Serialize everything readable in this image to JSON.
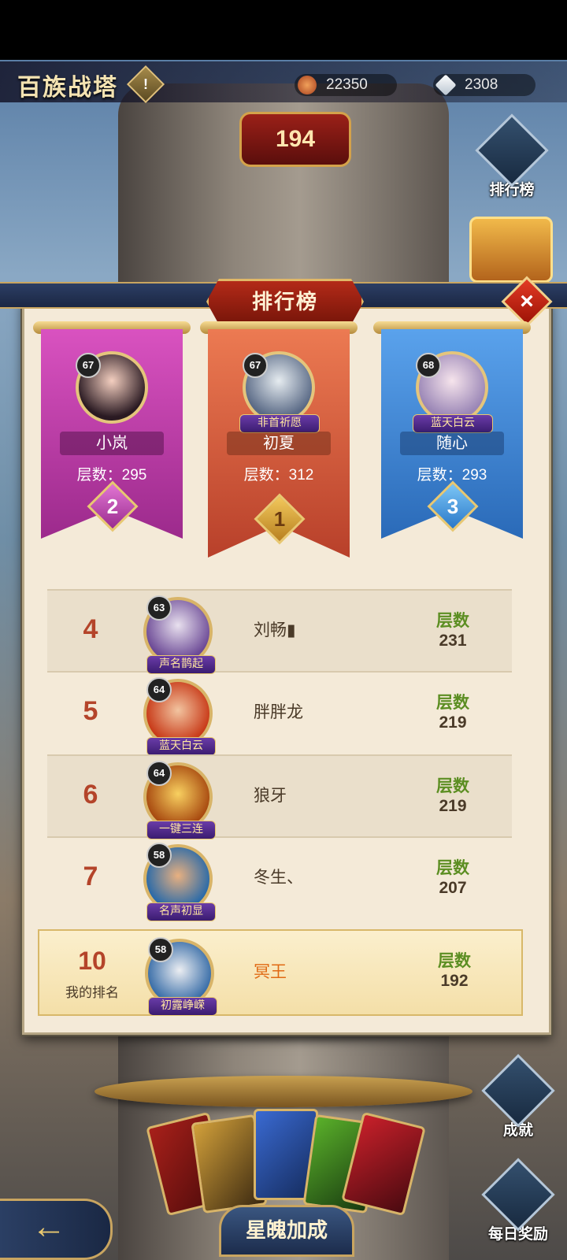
{
  "header": {
    "game_title": "百族战塔",
    "info_icon": "!",
    "currencies": [
      {
        "icon": "coin-icon",
        "value": "22350"
      },
      {
        "icon": "diamond-icon",
        "value": "2308"
      }
    ],
    "current_floor": "194"
  },
  "side_buttons": {
    "ranking": "排行榜",
    "achievement": "成就",
    "daily_reward": "每日奖励"
  },
  "modal": {
    "title": "排行榜",
    "close_icon": "×",
    "podium": [
      {
        "rank": "2",
        "level": "67",
        "name": "小岚",
        "layers": "层数：295",
        "title_tag": "",
        "color": "#c23fa8"
      },
      {
        "rank": "1",
        "level": "67",
        "name": "初夏",
        "layers": "层数：312",
        "title_tag": "非首祈愿",
        "color": "#e0653f"
      },
      {
        "rank": "3",
        "level": "68",
        "name": "随心",
        "layers": "层数：293",
        "title_tag": "蓝天白云",
        "color": "#3e8ad8"
      }
    ],
    "rows": [
      {
        "rank": "4",
        "level": "63",
        "title_tag": "声名鹊起",
        "name": "刘畅▮",
        "layers_label": "层数",
        "layers": "231"
      },
      {
        "rank": "5",
        "level": "64",
        "title_tag": "蓝天白云",
        "name": "胖胖龙",
        "layers_label": "层数",
        "layers": "219"
      },
      {
        "rank": "6",
        "level": "64",
        "title_tag": "一键三连",
        "name": "狼牙",
        "layers_label": "层数",
        "layers": "219"
      },
      {
        "rank": "7",
        "level": "58",
        "title_tag": "名声初显",
        "name": "冬生、",
        "layers_label": "层数",
        "layers": "207"
      }
    ],
    "my_row": {
      "rank": "10",
      "my_rank_label": "我的排名",
      "level": "58",
      "title_tag": "初露峥嵘",
      "name": "冥王",
      "layers_label": "层数",
      "layers": "192"
    }
  },
  "bottom": {
    "back_icon": "←",
    "title": "星魄加成"
  }
}
